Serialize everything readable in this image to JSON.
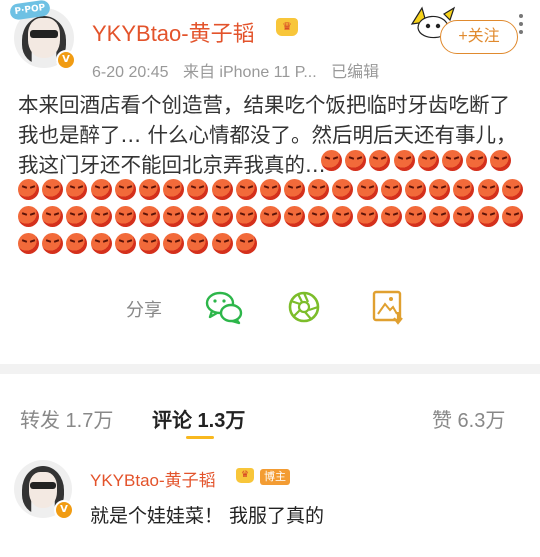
{
  "post": {
    "author": "YKYBtao-黄子韬",
    "avatar_sticker": "P·POP",
    "crown_badge": "♛",
    "meta": {
      "time": "6-20 20:45",
      "source": "来自 iPhone 11 P...",
      "edited": "已编辑"
    },
    "follow_label": "+关注",
    "text_lines": [
      "本来回酒店看个创造营，结果吃个饭把临时牙齿吃断了",
      "我也是醉了… 什么心情都没了。然后明后天还有事儿，",
      "我这门牙还不能回北京弄我真的…"
    ],
    "emoji_name": "angry-emoji",
    "emoji_rows": [
      8,
      21,
      21,
      10
    ],
    "share_label": "分享",
    "share_targets": [
      "wechat-icon",
      "moments-icon",
      "save-image-icon"
    ]
  },
  "tabs": {
    "repost": "转发 1.7万",
    "comment": "评论 1.3万",
    "like": "赞 6.3万"
  },
  "comment": {
    "author": "YKYBtao-黄子韬",
    "tag": "博主",
    "text": "就是个娃娃菜！ 我服了真的"
  },
  "colors": {
    "username": "#e3532b",
    "follow": "#e08a2e",
    "accent_underline": "#f8b81f"
  }
}
